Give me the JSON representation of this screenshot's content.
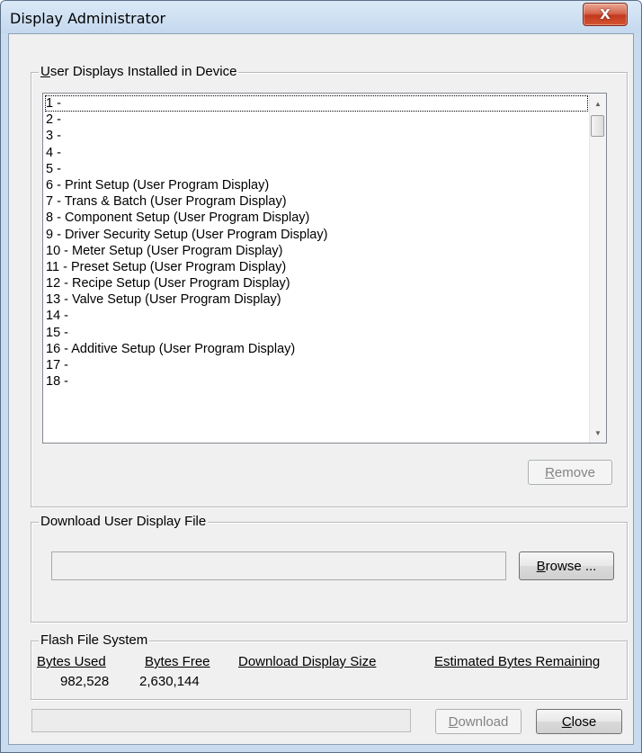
{
  "window": {
    "title": "Display Administrator",
    "close_glyph": "X"
  },
  "user_displays": {
    "label_accel": "U",
    "label_rest": "ser Displays Installed in Device",
    "items": [
      "1 -",
      "2 -",
      "3 -",
      "4 -",
      "5 -",
      "6 - Print Setup  (User Program Display)",
      "7 - Trans & Batch  (User Program Display)",
      "8 - Component Setup  (User Program Display)",
      "9 - Driver Security Setup  (User Program Display)",
      "10 - Meter Setup  (User Program Display)",
      "11 - Preset Setup  (User Program Display)",
      "12 - Recipe Setup  (User Program Display)",
      "13 - Valve Setup  (User Program Display)",
      "14 -",
      "15 -",
      "16 - Additive Setup  (User Program Display)",
      "17 -",
      "18 -"
    ],
    "remove_accel": "R",
    "remove_rest": "emove"
  },
  "download_file": {
    "label": "Download User Display File",
    "path_value": "",
    "browse_accel": "B",
    "browse_rest": "rowse ..."
  },
  "flash": {
    "label": "Flash File System",
    "col_bytes_used": "Bytes Used",
    "col_bytes_free": "Bytes Free",
    "col_download_size": "Download Display Size",
    "col_estimated_remaining": "Estimated Bytes Remaining",
    "bytes_used": "982,528",
    "bytes_free": "2,630,144",
    "download_size": "",
    "estimated_remaining": ""
  },
  "footer": {
    "download_accel": "D",
    "download_rest": "ownload",
    "close_accel": "C",
    "close_rest": "lose",
    "progress_fraction": 0
  },
  "icons": {
    "close": "close-icon",
    "scroll_up": "scroll-up-arrow-icon",
    "scroll_down": "scroll-down-arrow-icon"
  }
}
